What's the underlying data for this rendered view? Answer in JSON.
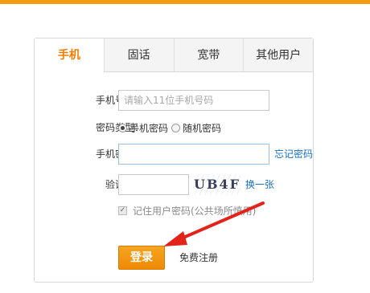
{
  "tabs": [
    {
      "label": "手机",
      "active": true
    },
    {
      "label": "固话",
      "active": false
    },
    {
      "label": "宽带",
      "active": false
    },
    {
      "label": "其他用户",
      "active": false
    }
  ],
  "form": {
    "phone_label": "手机号码：",
    "phone_placeholder": "请输入11位手机号码",
    "phone_value": "",
    "pwd_type_label": "密码类型：",
    "pwd_type_options": [
      "手机密码",
      "随机密码"
    ],
    "pwd_type_selected": "手机密码",
    "password_label": "手机密码：",
    "password_value": "",
    "forgot_link": "忘记密码",
    "captcha_label": "验证码：",
    "captcha_value": "",
    "captcha_text": "UB4F",
    "refresh_link": "换一张",
    "remember_label": "记住用户密码(公共场所慎用)",
    "remember_checked": true,
    "login_button": "登录",
    "register_link": "免费注册"
  },
  "colors": {
    "accent": "#f39b14",
    "link": "#1e6fb8",
    "arrow": "#e2231a"
  },
  "icons": {
    "annotation": "red-arrow-icon"
  }
}
